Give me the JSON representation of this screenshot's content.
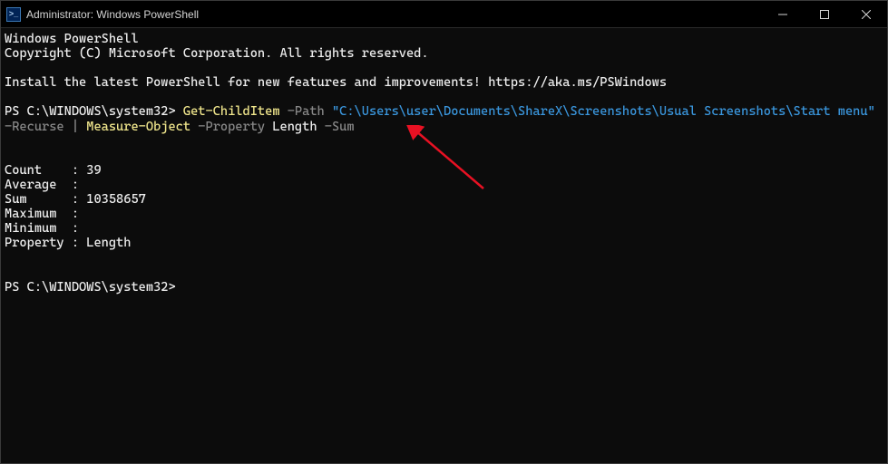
{
  "window": {
    "title": "Administrator: Windows PowerShell",
    "icon_label": ">_"
  },
  "banner": {
    "line1": "Windows PowerShell",
    "line2": "Copyright (C) Microsoft Corporation. All rights reserved.",
    "line3": "Install the latest PowerShell for new features and improvements! https://aka.ms/PSWindows"
  },
  "command1": {
    "prompt": "PS C:\\WINDOWS\\system32> ",
    "cmdlet1": "Get-ChildItem",
    "param1": " -Path ",
    "path": "\"C:\\Users\\user\\Documents\\ShareX\\Screenshots\\Usual Screenshots\\Start menu\"",
    "param2_seg1": " -R",
    "param2_seg2": "ecurse",
    "pipe": " | ",
    "cmdlet2": "Measure-Object",
    "param3": " -Property ",
    "arg3": "Length",
    "param4": " -Sum"
  },
  "output": {
    "rows": [
      {
        "label": "Count   ",
        "value": " 39"
      },
      {
        "label": "Average ",
        "value": ""
      },
      {
        "label": "Sum     ",
        "value": " 10358657"
      },
      {
        "label": "Maximum ",
        "value": ""
      },
      {
        "label": "Minimum ",
        "value": ""
      },
      {
        "label": "Property",
        "value": " Length"
      }
    ]
  },
  "command2": {
    "prompt": "PS C:\\WINDOWS\\system32> "
  }
}
